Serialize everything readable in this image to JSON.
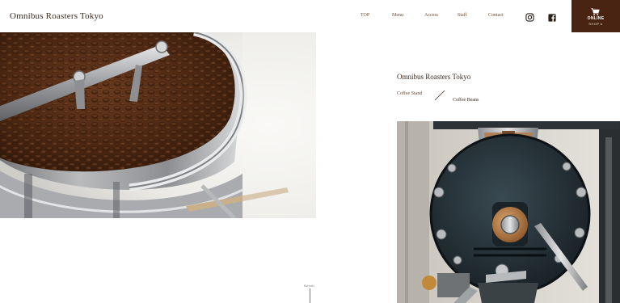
{
  "header": {
    "logo": "Omnibus Roasters Tokyo",
    "nav": [
      "TOP",
      "Menu",
      "Access",
      "Staff",
      "Contact"
    ],
    "social": [
      {
        "icon": "instagram-icon"
      },
      {
        "icon": "facebook-icon"
      }
    ],
    "online_shop": {
      "label": "ONLINE",
      "sub": "SHOP ▸",
      "icon": "cart-icon",
      "color": "#4a2412"
    }
  },
  "hero": {
    "image": "coffee-beans-roaster-photo"
  },
  "scroll": {
    "label": "Scroll"
  },
  "main": {
    "title": "Omnibus Roasters Tokyo",
    "breadcrumb": [
      "Coffee Stand",
      "Coffee Beans"
    ],
    "image": "roasting-machine-photo"
  }
}
